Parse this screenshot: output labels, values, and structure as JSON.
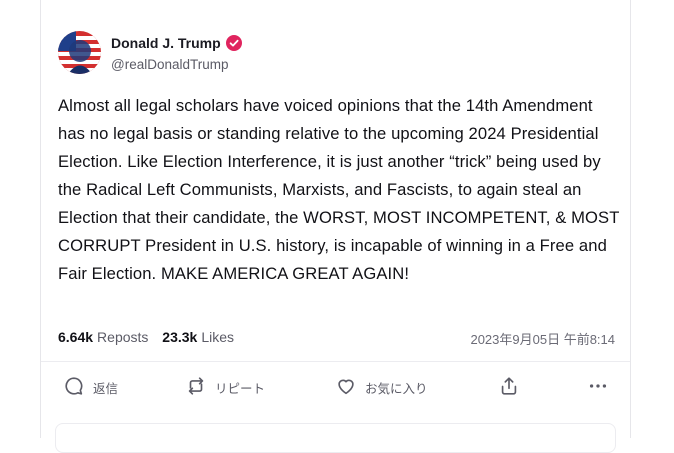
{
  "post": {
    "author": {
      "display_name": "Donald J. Trump",
      "handle": "@realDonaldTrump",
      "verified": true
    },
    "text": "Almost all legal scholars have voiced opinions that the 14th Amendment has no legal basis or standing relative to the upcoming 2024 Presidential Election. Like Election Interference, it is just another “trick” being used by the Radical Left Communists, Marxists, and Fascists, to again steal an Election that their candidate, the WORST, MOST INCOMPETENT, & MOST CORRUPT President in U.S. history, is incapable of winning in a Free and Fair Election. MAKE AMERICA GREAT AGAIN!",
    "stats": {
      "reposts_count": "6.64k",
      "reposts_label": "Reposts",
      "likes_count": "23.3k",
      "likes_label": "Likes"
    },
    "timestamp": "2023年9月05日 午前8:14"
  },
  "actions": {
    "reply": {
      "label": "返信",
      "icon": "reply-icon"
    },
    "repost": {
      "label": "リピート",
      "icon": "repost-icon"
    },
    "like": {
      "label": "お気に入り",
      "icon": "heart-icon"
    },
    "share": {
      "icon": "share-icon"
    },
    "more": {
      "icon": "more-icon"
    }
  },
  "colors": {
    "verified_badge": "#e0245e",
    "text_primary": "#111116",
    "text_secondary": "#5b5b66"
  }
}
